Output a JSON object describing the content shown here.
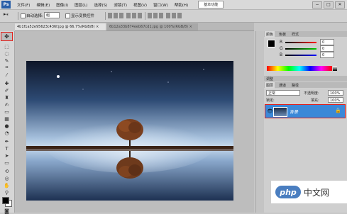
{
  "app": {
    "logo": "Ps"
  },
  "menu": {
    "items": [
      "文件(F)",
      "编辑(E)",
      "图像(I)",
      "图层(L)",
      "选择(S)",
      "滤镜(T)",
      "视图(V)",
      "窗口(W)",
      "帮助(H)"
    ],
    "workspace": "基本功能"
  },
  "window_buttons": [
    "−",
    "□",
    "✕"
  ],
  "options": {
    "auto_select_label": "自动选择:",
    "auto_select_value": "组",
    "transform_label": "显示变换控件"
  },
  "tabs": {
    "active": "4b1f1a52e95623c436f.jpg @ 66.7%(RGB/8) ×",
    "inactive": "6b12a33b874eeb67cd1.jpg @ 100%(RGB/8) ×"
  },
  "panels": {
    "color_tabs": [
      "颜色",
      "色板",
      "样式"
    ],
    "channels": [
      "R",
      "G",
      "B"
    ],
    "channel_values": [
      "0",
      "0",
      "0"
    ],
    "adjust_tab": "调整",
    "layers_tabs": [
      "图层",
      "通道",
      "路径"
    ],
    "blend_mode": "正常",
    "opacity_label": "不透明度:",
    "opacity_value": "100%",
    "lock_label": "锁定:",
    "fill_label": "填充:",
    "fill_value": "100%",
    "layer_name": "背景"
  },
  "watermark": {
    "logo": "php",
    "site": "中文网"
  },
  "colors": {
    "accent_red": "#e2201b",
    "layer_selected": "#3b88d8"
  }
}
